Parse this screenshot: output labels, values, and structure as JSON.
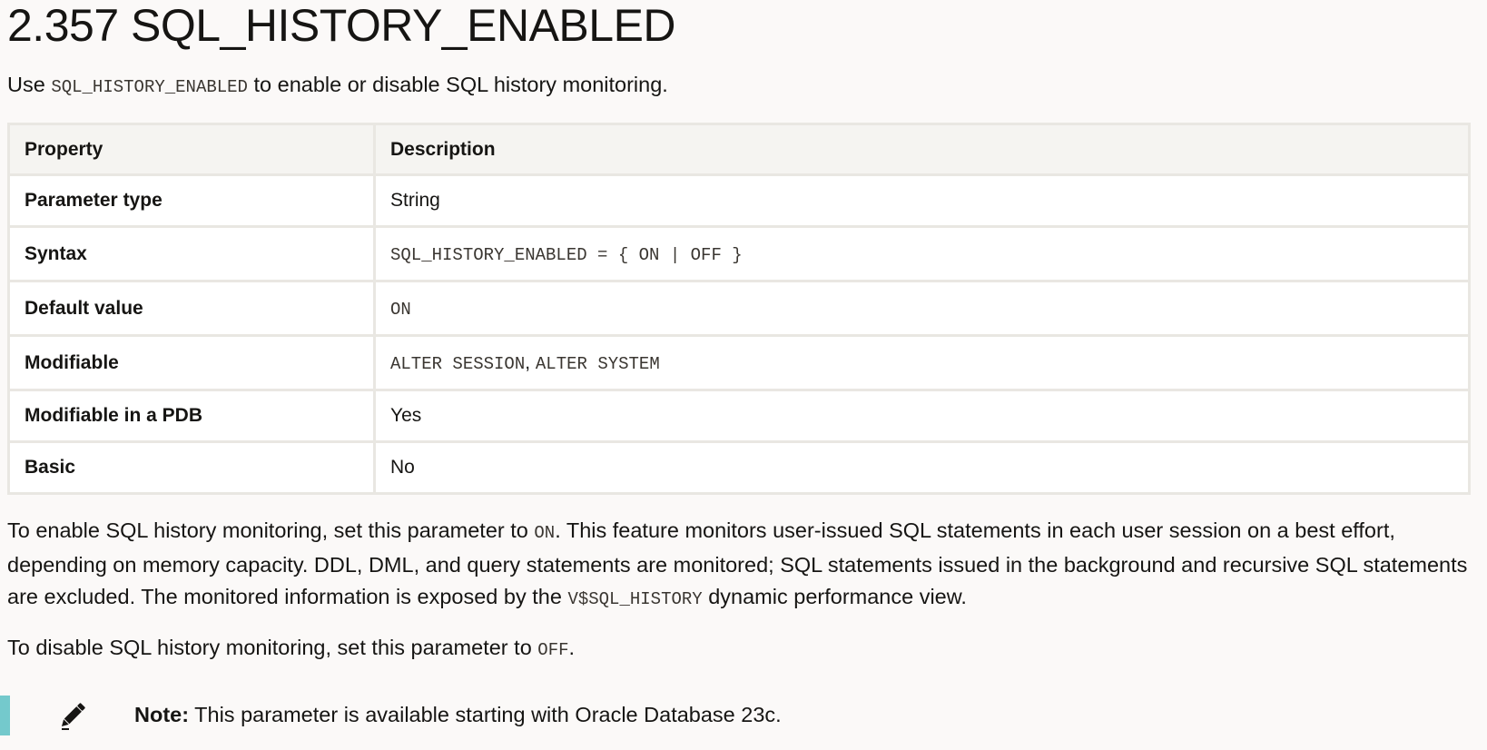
{
  "title": "2.357 SQL_HISTORY_ENABLED",
  "intro": {
    "before": "Use ",
    "code": "SQL_HISTORY_ENABLED",
    "after": " to enable or disable SQL history monitoring."
  },
  "table": {
    "headers": [
      "Property",
      "Description"
    ],
    "rows": [
      {
        "property": "Parameter type",
        "value": "String"
      },
      {
        "property": "Syntax",
        "value": "SQL_HISTORY_ENABLED = { ON | OFF }"
      },
      {
        "property": "Default value",
        "value": "ON"
      },
      {
        "property": "Modifiable",
        "value_code_1": "ALTER SESSION",
        "separator": ", ",
        "value_code_2": "ALTER SYSTEM"
      },
      {
        "property": "Modifiable in a PDB",
        "value": "Yes"
      },
      {
        "property": "Basic",
        "value": "No"
      }
    ]
  },
  "paragraph1": {
    "part1": "To enable SQL history monitoring, set this parameter to ",
    "code1": "ON",
    "part2": ". This feature monitors user-issued SQL statements in each user session on a best effort, depending on memory capacity. DDL, DML, and query statements are monitored; SQL statements issued in the background and recursive SQL statements are excluded. The monitored information is exposed by the ",
    "code2": "V$SQL_HISTORY",
    "part3": " dynamic performance view."
  },
  "paragraph2": {
    "part1": "To disable SQL history monitoring, set this parameter to ",
    "code1": "OFF",
    "part2": "."
  },
  "note": {
    "label": "Note:",
    "text": " This parameter is available starting with Oracle Database 23c.",
    "icon": "pencil-icon",
    "accent_color": "#74c9cc"
  }
}
